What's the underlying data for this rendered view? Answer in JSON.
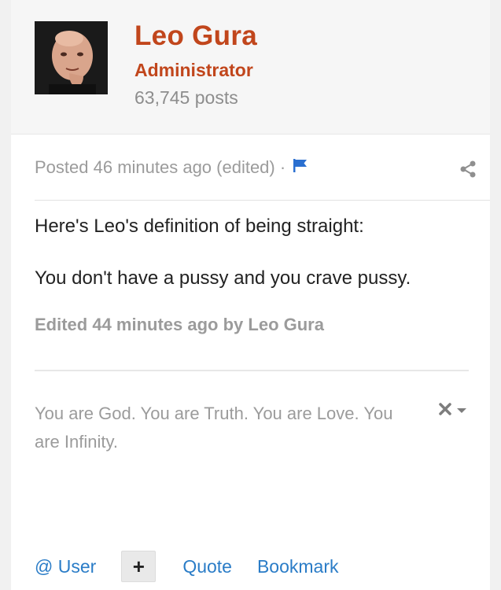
{
  "author": {
    "name": "Leo Gura",
    "title": "Administrator",
    "post_count": "63,745 posts"
  },
  "post": {
    "meta": "Posted 46 minutes ago (edited) ·",
    "paragraphs": [
      "Here's Leo's definition of being straight:",
      "You don't have a pussy and you crave pussy."
    ],
    "edited_note": "Edited 44 minutes ago by Leo Gura"
  },
  "signature": {
    "text": "You are God. You are Truth. You are Love. You are Infinity."
  },
  "actions": {
    "mention": "@ User",
    "plus": "+",
    "quote": "Quote",
    "bookmark": "Bookmark"
  },
  "icons": {
    "flag": "flag-icon",
    "share": "share-icon",
    "close": "close-icon",
    "dropdown": "caret-down-icon"
  },
  "colors": {
    "accent": "#c1461c",
    "link": "#2a7cc7",
    "muted": "#9b9b9b"
  }
}
